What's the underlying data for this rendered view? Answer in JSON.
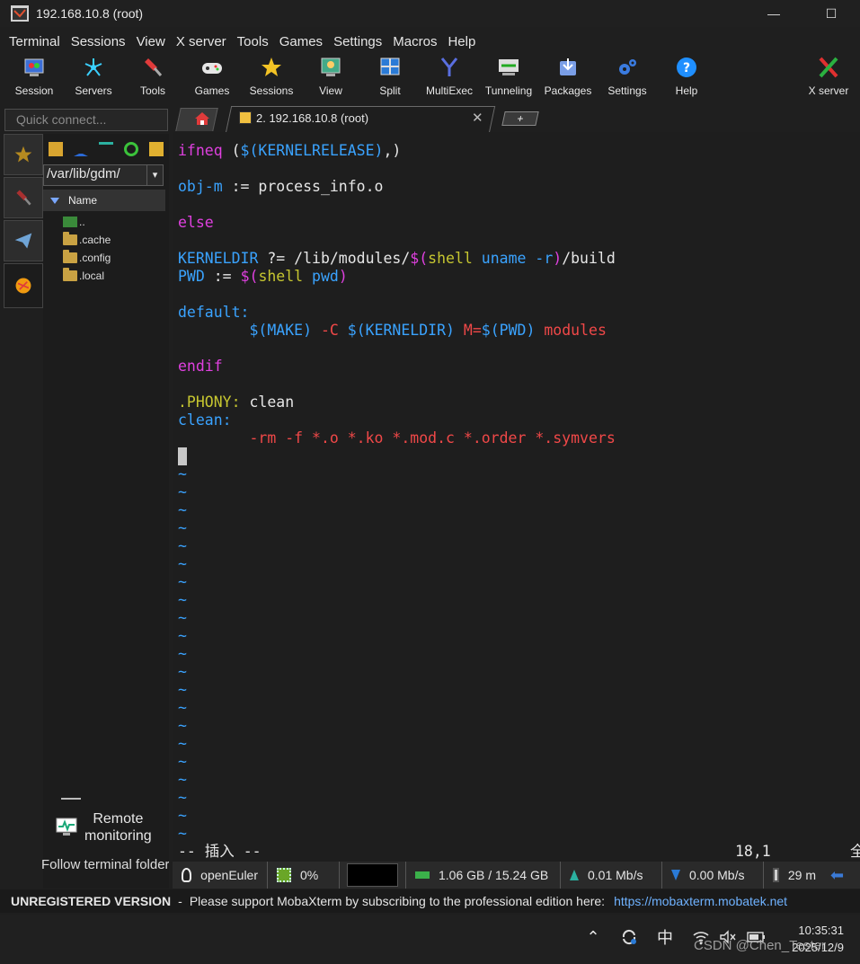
{
  "window": {
    "title": "192.168.10.8 (root)",
    "minimize_glyph": "—",
    "maximize_glyph": "☐"
  },
  "menu": [
    "Terminal",
    "Sessions",
    "View",
    "X server",
    "Tools",
    "Games",
    "Settings",
    "Macros",
    "Help"
  ],
  "toolbar": [
    {
      "label": "Session",
      "icon": "session-icon"
    },
    {
      "label": "Servers",
      "icon": "servers-icon"
    },
    {
      "label": "Tools",
      "icon": "tools-icon"
    },
    {
      "label": "Games",
      "icon": "games-icon"
    },
    {
      "label": "Sessions",
      "icon": "sessions-star-icon"
    },
    {
      "label": "View",
      "icon": "view-icon"
    },
    {
      "label": "Split",
      "icon": "split-icon"
    },
    {
      "label": "MultiExec",
      "icon": "multiexec-icon"
    },
    {
      "label": "Tunneling",
      "icon": "tunneling-icon"
    },
    {
      "label": "Packages",
      "icon": "packages-icon"
    },
    {
      "label": "Settings",
      "icon": "settings-icon"
    },
    {
      "label": "Help",
      "icon": "help-icon"
    },
    {
      "label": "X server",
      "icon": "xserver-icon"
    }
  ],
  "quick_connect": {
    "placeholder": "Quick connect..."
  },
  "tabs": {
    "active_label": "2. 192.168.10.8 (root)",
    "close_glyph": "✕",
    "new_tab_glyph": "+"
  },
  "file_browser": {
    "path": "/var/lib/gdm/",
    "column_name": "Name",
    "entries": [
      "..",
      ".cache",
      ".config",
      ".local"
    ],
    "remote_monitoring_line1": "Remote",
    "remote_monitoring_line2": "monitoring",
    "follow_folder": "Follow terminal folder"
  },
  "terminal": {
    "lines": {
      "l1a": "ifneq",
      "l1b": " (",
      "l1c": "$(KERNELRELEASE)",
      "l1d": ",)",
      "l3a": "obj-m",
      "l3b": " := process_info.o",
      "l5": "else",
      "l7a": "KERNELDIR",
      "l7b": " ?= /lib/modules/",
      "l7c": "$(",
      "l7d": "shell",
      "l7e": " uname -r",
      "l7f": ")",
      "l7g": "/build",
      "l8a": "PWD",
      "l8b": " := ",
      "l8c": "$(",
      "l8d": "shell",
      "l8e": " pwd",
      "l8f": ")",
      "l10": "default:",
      "l11a": "        $(MAKE)",
      "l11b": " -C ",
      "l11c": "$(KERNELDIR)",
      "l11d": " M=",
      "l11e": "$(PWD)",
      "l11f": " modules",
      "l13": "endif",
      "l15a": ".PHONY:",
      "l15b": " clean",
      "l16": "clean:",
      "l17": "        -rm -f *.o *.ko *.mod.c *.order *.symvers"
    },
    "tilde": "~",
    "mode_line": "-- 插入 --",
    "position": "18,1",
    "right_glyph": "全"
  },
  "status": {
    "os": "openEuler",
    "cpu": "0%",
    "memory": "1.06 GB / 15.24 GB",
    "upload": "0.01 Mb/s",
    "download": "0.00 Mb/s",
    "uptime": "29 m"
  },
  "banner": {
    "unregistered": "UNREGISTERED VERSION",
    "dash": "-",
    "message": "Please support MobaXterm by subscribing to the professional edition here:",
    "link": "https://mobaxterm.mobatek.net"
  },
  "taskbar": {
    "ime": "中",
    "time": "10:35:31",
    "date": "2025/12/9",
    "watermark": "CSDN @Chen_Tester"
  }
}
